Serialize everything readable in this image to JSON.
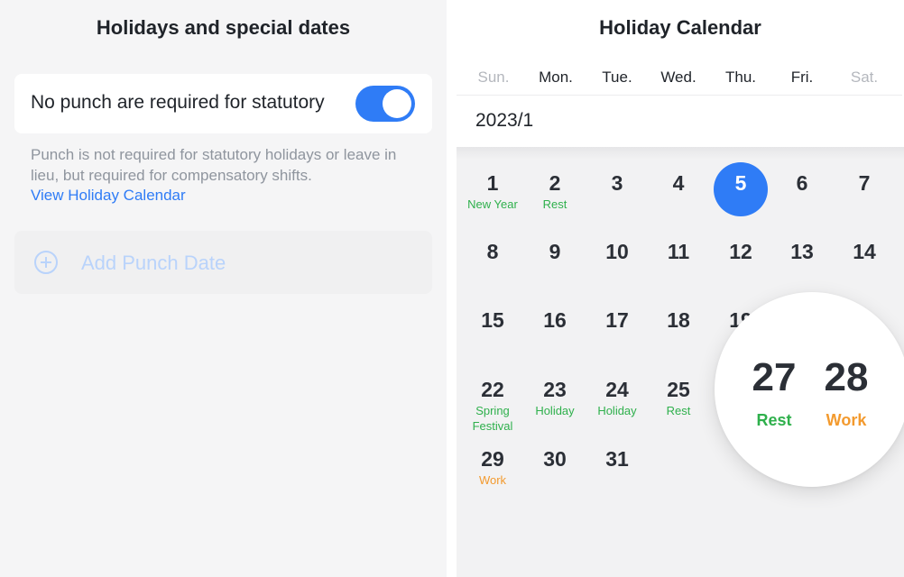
{
  "left": {
    "title": "Holidays and special dates",
    "toggle": {
      "label": "No punch are required for statutory",
      "on": true
    },
    "description": "Punch is not required for statutory holidays or leave in lieu, but required for compensatory shifts.",
    "calendar_link": "View Holiday Calendar",
    "add_punch_label": "Add Punch Date"
  },
  "calendar": {
    "title": "Holiday Calendar",
    "weekdays": [
      "Sun.",
      "Mon.",
      "Tue.",
      "Wed.",
      "Thu.",
      "Fri.",
      "Sat."
    ],
    "month": "2023/1",
    "today": "5",
    "days": [
      {
        "n": "1",
        "tag": "New Year",
        "type": "rest"
      },
      {
        "n": "2",
        "tag": "Rest",
        "type": "rest"
      },
      {
        "n": "3"
      },
      {
        "n": "4"
      },
      {
        "n": "5"
      },
      {
        "n": "6"
      },
      {
        "n": "7"
      },
      {
        "n": "8"
      },
      {
        "n": "9"
      },
      {
        "n": "10"
      },
      {
        "n": "11"
      },
      {
        "n": "12"
      },
      {
        "n": "13"
      },
      {
        "n": "14"
      },
      {
        "n": "15"
      },
      {
        "n": "16"
      },
      {
        "n": "17"
      },
      {
        "n": "18"
      },
      {
        "n": "19"
      },
      {
        "n": "22",
        "tag": "Spring Festival",
        "type": "rest"
      },
      {
        "n": "23",
        "tag": "Holiday",
        "type": "rest"
      },
      {
        "n": "24",
        "tag": "Holiday",
        "type": "rest"
      },
      {
        "n": "25",
        "tag": "Rest",
        "type": "rest"
      },
      {
        "n": "29",
        "tag": "Work",
        "type": "work"
      },
      {
        "n": "30"
      },
      {
        "n": "31"
      }
    ],
    "magnified": [
      {
        "n": "27",
        "tag": "Rest",
        "type": "rest"
      },
      {
        "n": "28",
        "tag": "Work",
        "type": "work"
      }
    ]
  },
  "colors": {
    "accent": "#2f7cf6",
    "rest": "#2fb04c",
    "work": "#f39a2e"
  }
}
